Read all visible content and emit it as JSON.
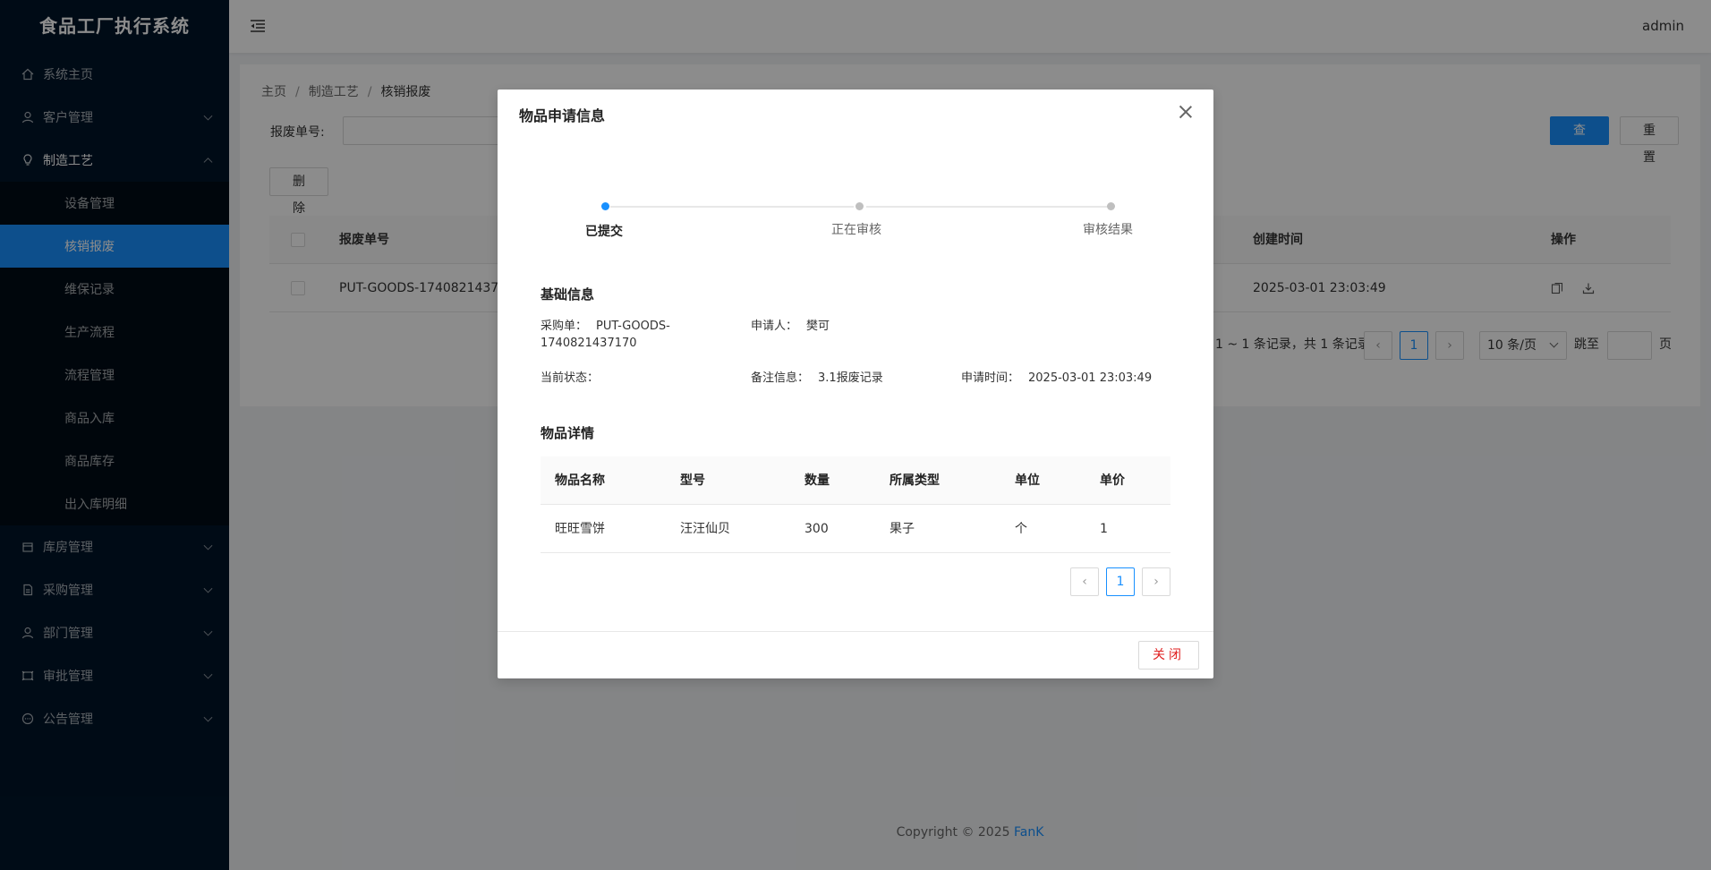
{
  "app": {
    "title": "食品工厂执行系统",
    "user": "admin"
  },
  "sidebar": {
    "items": [
      {
        "label": "系统主页",
        "icon": "home-icon"
      },
      {
        "label": "客户管理",
        "icon": "user-icon"
      },
      {
        "label": "制造工艺",
        "icon": "bulb-icon",
        "expanded": true,
        "children": [
          "设备管理",
          "核销报废",
          "维保记录",
          "生产流程",
          "流程管理",
          "商品入库",
          "商品库存",
          "出入库明细"
        ],
        "active_child": "核销报废"
      },
      {
        "label": "库房管理",
        "icon": "box-icon"
      },
      {
        "label": "采购管理",
        "icon": "file-icon"
      },
      {
        "label": "部门管理",
        "icon": "team-icon"
      },
      {
        "label": "审批管理",
        "icon": "approve-icon"
      },
      {
        "label": "公告管理",
        "icon": "message-icon"
      }
    ]
  },
  "breadcrumb": [
    "主页",
    "制造工艺",
    "核销报废"
  ],
  "search": {
    "label": "报废单号:",
    "query_button": "查 询",
    "reset_button": "重 置"
  },
  "toolbar": {
    "delete_button": "删 除"
  },
  "table": {
    "columns": {
      "no": "报废单号",
      "created": "创建时间",
      "actions": "操作"
    },
    "rows": [
      {
        "no": "PUT-GOODS-17408214371",
        "created": "2025-03-01 23:03:49"
      }
    ]
  },
  "pagination": {
    "summary": "1 ~ 1 条记录，共 1 条记录",
    "current": "1",
    "page_size": "10 条/页",
    "jump_label": "跳至",
    "page_unit": "页"
  },
  "footer": {
    "copyright": "Copyright © 2025",
    "brand": "FanK"
  },
  "modal": {
    "title": "物品申请信息",
    "steps": [
      "已提交",
      "正在审核",
      "审核结果"
    ],
    "current_step": 0,
    "basic_title": "基础信息",
    "basic": {
      "order_label": "采购单：",
      "order_value": "PUT-GOODS-",
      "order_value2": "1740821437170",
      "applicant_label": "申请人：",
      "applicant_value": "樊可",
      "status_label": "当前状态：",
      "status_value": "",
      "remark_label": "备注信息：",
      "remark_value": "3.1报废记录",
      "time_label": "申请时间：",
      "time_value": "2025-03-01 23:03:49"
    },
    "detail_title": "物品详情",
    "detail_columns": [
      "物品名称",
      "型号",
      "数量",
      "所属类型",
      "单位",
      "单价"
    ],
    "detail_rows": [
      [
        "旺旺雪饼",
        "汪汪仙贝",
        "300",
        "果子",
        "个",
        "1"
      ]
    ],
    "page": "1",
    "close_button": "关闭"
  },
  "colors": {
    "primary": "#1890ff",
    "sidebar_bg": "#001529",
    "danger": "#e02020"
  }
}
